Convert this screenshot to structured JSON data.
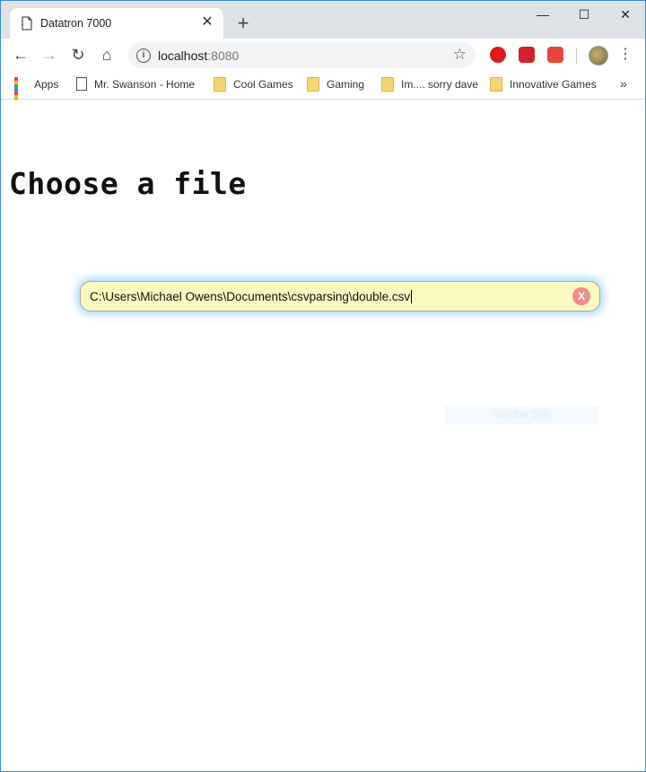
{
  "browser": {
    "tab_title": "Datatron 7000",
    "tab_close": "✕",
    "new_tab": "+",
    "window_controls": {
      "minimize": "—",
      "maximize": "☐",
      "close": "✕"
    },
    "nav": {
      "back": "←",
      "forward": "→",
      "reload": "↻",
      "home": "⌂"
    },
    "url_host": "localhost",
    "url_port": ":8080",
    "star": "☆",
    "menu": "⋮",
    "bookmarks": [
      {
        "label": "Apps"
      },
      {
        "label": "Mr. Swanson - Home"
      },
      {
        "label": "Cool Games"
      },
      {
        "label": "Gaming"
      },
      {
        "label": "Im.... sorry dave"
      },
      {
        "label": "Innovative Games"
      }
    ],
    "bookmarks_more": "»"
  },
  "page": {
    "heading": "Choose a file",
    "file_path": "C:\\Users\\Michael Owens\\Documents\\csvparsing\\double.csv",
    "clear_label": "X"
  },
  "overlay": {
    "snip_label": "Window Snip"
  },
  "colors": {
    "input_bg": "#fafac0",
    "input_glow": "#a3d6f5",
    "clear_bg": "#f28b8b",
    "window_border": "#3c8ad6"
  }
}
